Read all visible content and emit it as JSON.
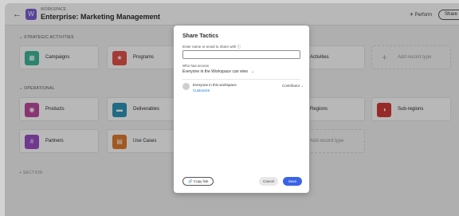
{
  "topbar": {
    "back_icon": "←",
    "workspace_icon": "W",
    "workspace_sup": "WORKSPACE",
    "workspace_title": "Enterprise: Marketing Management",
    "chevron": "⌄",
    "more": "···",
    "right_text": "✈ Perform",
    "right_button": "Share"
  },
  "sections": [
    {
      "title": "⌄  STRATEGIC ACTIVITIES",
      "cards": [
        {
          "label": "Campaigns",
          "icon": "▦",
          "color": "#3db89a"
        },
        {
          "label": "Programs",
          "icon": "★",
          "color": "#e5534b"
        },
        {
          "label": "Activities",
          "icon": "",
          "color": ""
        },
        {
          "label": "Add record type",
          "icon": "+",
          "color": ""
        }
      ]
    },
    {
      "title": "⌄  OPERATIONAL",
      "cards": [
        {
          "label": "Products",
          "icon": "◉",
          "color": "#c04aa0"
        },
        {
          "label": "Deliverables",
          "icon": "▬",
          "color": "#2f95b8"
        },
        {
          "label": "Regions",
          "icon": "",
          "color": ""
        },
        {
          "label": "Sub-regions",
          "icon": "◑",
          "color": "#d23a3a"
        },
        {
          "label": "Partners",
          "icon": "#",
          "color": "#9b4fc7"
        },
        {
          "label": "Use Cases",
          "icon": "▤",
          "color": "#e07a2e"
        },
        {
          "label": "Add record type",
          "icon": "",
          "color": ""
        }
      ]
    }
  ],
  "bottom_section": "+  SECTION",
  "modal": {
    "title": "Share Tactics",
    "input_label": "Enter name or email to share with  ⓘ",
    "input_value": "",
    "access_label": "Who has access",
    "access_value": "Everyone in the Workspace can view",
    "access_chevron": "⌄",
    "user_name": "Everyone in this workspace",
    "user_link": "Customize",
    "user_role": "Contributor  ⌄",
    "copy_link": "🔗 Copy link",
    "cancel": "Cancel",
    "save": "Save"
  }
}
